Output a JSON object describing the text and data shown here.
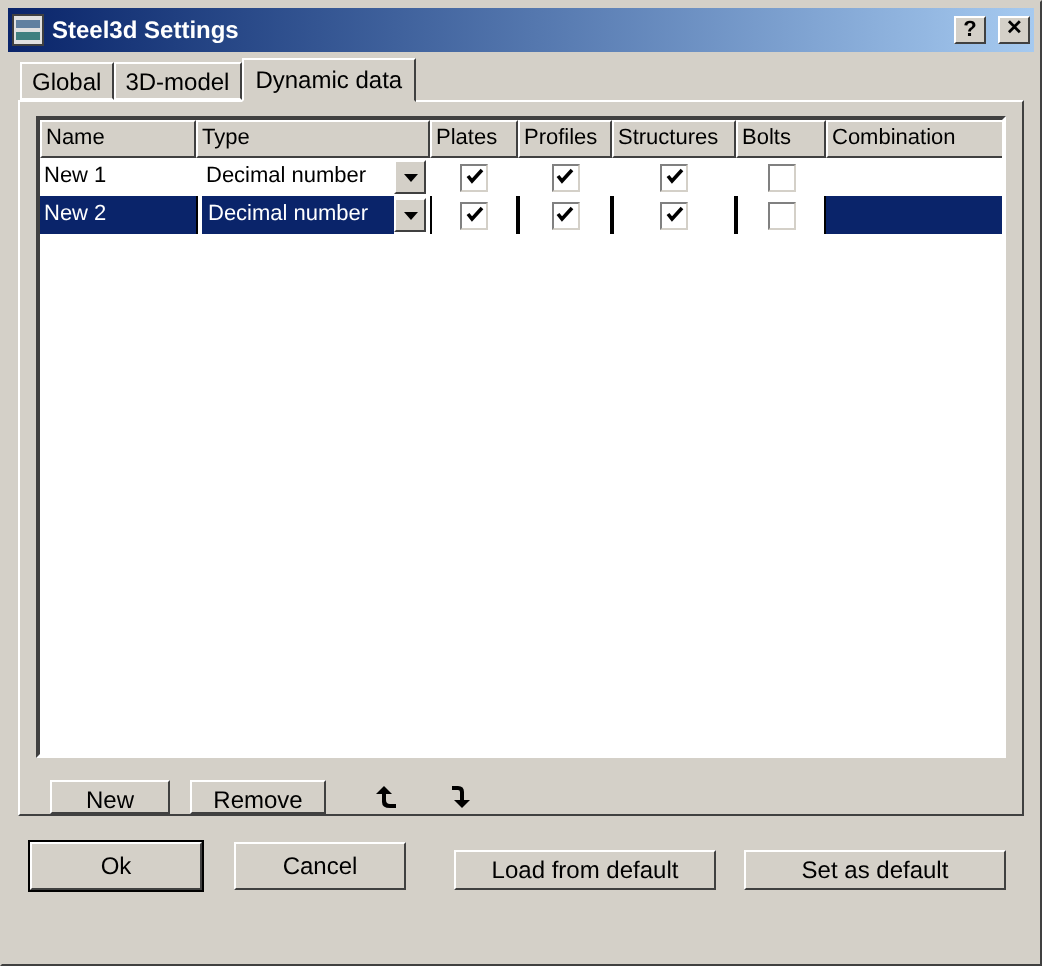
{
  "window": {
    "title": "Steel3d Settings",
    "help_button": "?",
    "close_button": "✕"
  },
  "tabs": [
    {
      "label": "Global",
      "selected": false
    },
    {
      "label": "3D-model",
      "selected": false
    },
    {
      "label": "Dynamic data",
      "selected": true
    }
  ],
  "table": {
    "columns": [
      "Name",
      "Type",
      "Plates",
      "Profiles",
      "Structures",
      "Bolts",
      "Combination"
    ],
    "rows": [
      {
        "name": "New 1",
        "type": "Decimal number",
        "plates": true,
        "profiles": true,
        "structures": true,
        "bolts": false,
        "selected": false
      },
      {
        "name": "New 2",
        "type": "Decimal number",
        "plates": true,
        "profiles": true,
        "structures": true,
        "bolts": false,
        "selected": true
      }
    ]
  },
  "list_buttons": [
    "New",
    "Remove"
  ],
  "dialog_buttons": [
    {
      "label": "Ok",
      "default": true
    },
    {
      "label": "Cancel",
      "default": false
    }
  ],
  "default_buttons": [
    "Load from default",
    "Set as default"
  ]
}
